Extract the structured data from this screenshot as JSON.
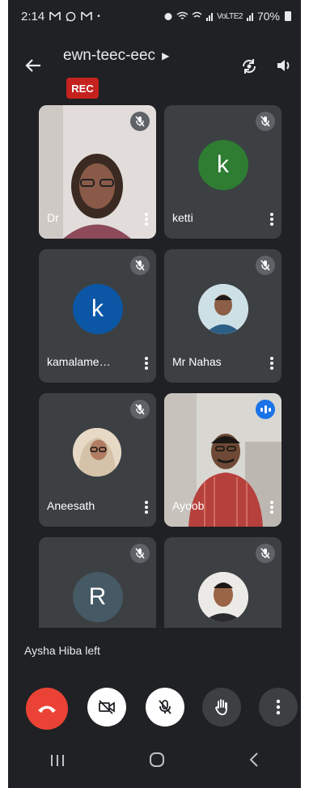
{
  "status_bar": {
    "time": "2:14",
    "left_icons": [
      "gmail-icon",
      "whatsapp-icon",
      "gmail-icon",
      "dot-icon"
    ],
    "volte": "VoLTE2",
    "battery": "70%"
  },
  "header": {
    "title": "ewn-teec-eec",
    "rec_badge": "REC"
  },
  "participants": [
    {
      "name": "Dr",
      "muted": true,
      "type": "video"
    },
    {
      "name": "ketti",
      "muted": true,
      "type": "letter",
      "letter": "k",
      "color": "#2e7d32"
    },
    {
      "name": "kamalame…",
      "muted": true,
      "type": "letter",
      "letter": "k",
      "color": "#0b57a6"
    },
    {
      "name": "Mr Nahas",
      "muted": true,
      "type": "photo"
    },
    {
      "name": "Aneesath",
      "muted": true,
      "type": "photo"
    },
    {
      "name": "Ayoob",
      "muted": false,
      "speaking": true,
      "type": "video"
    },
    {
      "name": "",
      "muted": true,
      "type": "letter",
      "letter": "R",
      "color": "#455a64"
    },
    {
      "name": "",
      "muted": true,
      "type": "photo"
    }
  ],
  "toast": "Aysha Hiba left",
  "controls": {
    "colors": {
      "end_call": "#ea4335",
      "dark_button": "#3c4043"
    }
  }
}
